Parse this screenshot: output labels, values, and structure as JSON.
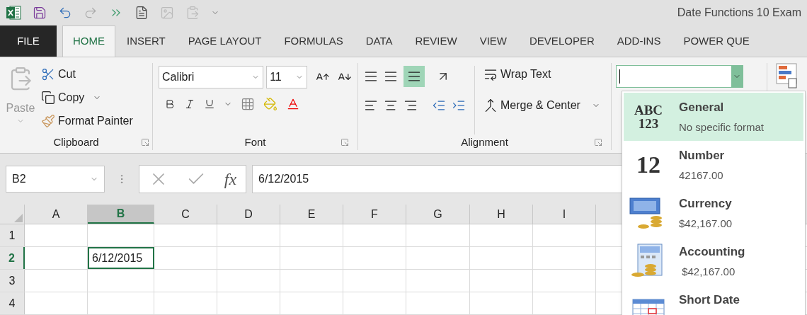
{
  "title_bar": {
    "title": "Date Functions 10 Exam"
  },
  "tabs": [
    {
      "label": "FILE",
      "kind": "file",
      "selected": false
    },
    {
      "label": "HOME",
      "kind": "tab",
      "selected": true
    },
    {
      "label": "INSERT",
      "kind": "tab",
      "selected": false
    },
    {
      "label": "PAGE LAYOUT",
      "kind": "tab",
      "selected": false
    },
    {
      "label": "FORMULAS",
      "kind": "tab",
      "selected": false
    },
    {
      "label": "DATA",
      "kind": "tab",
      "selected": false
    },
    {
      "label": "REVIEW",
      "kind": "tab",
      "selected": false
    },
    {
      "label": "VIEW",
      "kind": "tab",
      "selected": false
    },
    {
      "label": "DEVELOPER",
      "kind": "tab",
      "selected": false
    },
    {
      "label": "ADD-INS",
      "kind": "tab",
      "selected": false
    },
    {
      "label": "POWER QUE",
      "kind": "tab",
      "selected": false
    }
  ],
  "ribbon": {
    "clipboard": {
      "label": "Clipboard",
      "paste": "Paste",
      "cut": "Cut",
      "copy": "Copy",
      "format_painter": "Format Painter"
    },
    "font": {
      "label": "Font",
      "font_name": "Calibri",
      "font_size": "11"
    },
    "alignment": {
      "label": "Alignment",
      "bottom_align_selected": true,
      "wrap_text": "Wrap Text",
      "merge_center": "Merge & Center"
    },
    "number_format": {
      "expanded": true
    }
  },
  "formula_bar": {
    "name_box": "B2",
    "function_label": "fx",
    "formula": "6/12/2015"
  },
  "grid": {
    "columns": [
      {
        "label": "A",
        "selected": false
      },
      {
        "label": "B",
        "selected": true
      },
      {
        "label": "C",
        "selected": false
      },
      {
        "label": "D",
        "selected": false
      },
      {
        "label": "E",
        "selected": false
      },
      {
        "label": "F",
        "selected": false
      },
      {
        "label": "G",
        "selected": false
      },
      {
        "label": "H",
        "selected": false
      },
      {
        "label": "I",
        "selected": false
      }
    ],
    "rows": [
      {
        "label": "1",
        "selected": false,
        "cells": []
      },
      {
        "label": "2",
        "selected": true,
        "cells": [
          {
            "selected": false
          },
          {
            "value": "6/12/2015",
            "selected": true
          }
        ]
      },
      {
        "label": "3",
        "selected": false,
        "cells": []
      },
      {
        "label": "4",
        "selected": false,
        "cells": []
      }
    ]
  },
  "format_menu": {
    "items": [
      {
        "kind": "general",
        "glyph": [
          "ABC",
          "123"
        ],
        "name": "General",
        "example": "No specific format",
        "selected": true
      },
      {
        "kind": "number",
        "glyph": [
          "12"
        ],
        "name": "Number",
        "example": "42167.00",
        "selected": false
      },
      {
        "kind": "currency",
        "name": "Currency",
        "example": "$42,167.00",
        "selected": false
      },
      {
        "kind": "accounting",
        "name": "Accounting",
        "example": " $42,167.00",
        "selected": false
      },
      {
        "kind": "date",
        "name": "Short Date",
        "selected": false
      }
    ]
  }
}
